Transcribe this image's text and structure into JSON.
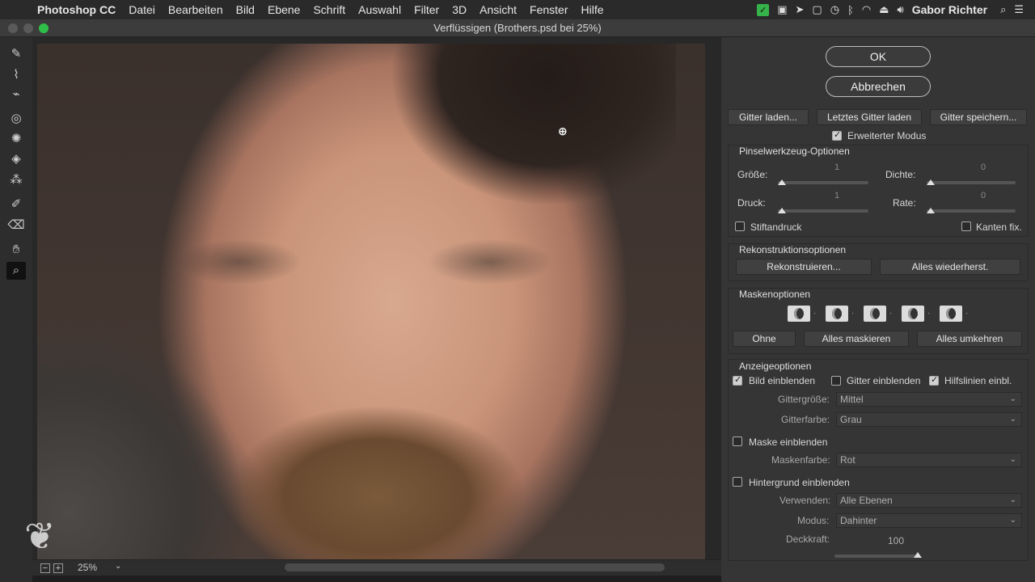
{
  "menubar": {
    "apple": "",
    "app": "Photoshop CC",
    "items": [
      "Datei",
      "Bearbeiten",
      "Bild",
      "Ebene",
      "Schrift",
      "Auswahl",
      "Filter",
      "3D",
      "Ansicht",
      "Fenster",
      "Hilfe"
    ],
    "user": "Gabor Richter"
  },
  "window": {
    "title": "Verflüssigen (Brothers.psd bei 25%)"
  },
  "status": {
    "zoom": "25%"
  },
  "panel": {
    "ok": "OK",
    "cancel": "Abbrechen",
    "mesh_buttons": [
      "Gitter laden...",
      "Letztes Gitter laden",
      "Gitter speichern..."
    ],
    "advanced_mode": "Erweiterter Modus",
    "brush_section": "Pinselwerkzeug-Optionen",
    "size_label": "Größe:",
    "size_value": "1",
    "density_label": "Dichte:",
    "density_value": "0",
    "pressure_label": "Druck:",
    "pressure_value": "1",
    "rate_label": "Rate:",
    "rate_value": "0",
    "stylus": "Stiftandruck",
    "pin_edges": "Kanten fix.",
    "recon_section": "Rekonstruktionsoptionen",
    "reconstruct": "Rekonstruieren...",
    "restore_all": "Alles wiederherst.",
    "mask_section": "Maskenoptionen",
    "mask_none": "Ohne",
    "mask_all": "Alles maskieren",
    "mask_invert": "Alles umkehren",
    "view_section": "Anzeigeoptionen",
    "show_image": "Bild einblenden",
    "show_mesh": "Gitter einblenden",
    "show_guides": "Hilfslinien einbl.",
    "mesh_size_label": "Gittergröße:",
    "mesh_size_value": "Mittel",
    "mesh_color_label": "Gitterfarbe:",
    "mesh_color_value": "Grau",
    "show_mask": "Maske einblenden",
    "mask_color_label": "Maskenfarbe:",
    "mask_color_value": "Rot",
    "show_backdrop": "Hintergrund einblenden",
    "use_label": "Verwenden:",
    "use_value": "Alle Ebenen",
    "mode_label": "Modus:",
    "mode_value": "Dahinter",
    "opacity_label": "Deckkraft:",
    "opacity_value": "100"
  }
}
